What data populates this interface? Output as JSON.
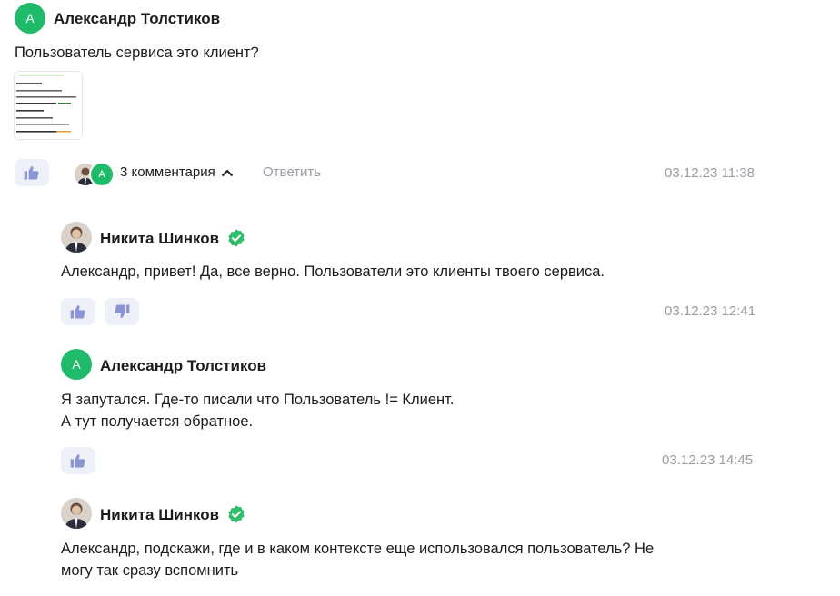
{
  "post": {
    "avatar_letter": "А",
    "author": "Александр Толстиков",
    "text": "Пользователь сервиса это клиент?",
    "comments_label": "3 комментария",
    "reply_label": "Ответить",
    "date": "03.12.23 11:38",
    "mini_avatar_letter": "А"
  },
  "comments": [
    {
      "author": "Никита Шинков",
      "text": "Александр, привет! Да, все верно. Пользователи это клиенты твоего сервиса.",
      "date": "03.12.23 12:41"
    },
    {
      "avatar_letter": "А",
      "author": "Александр Толстиков",
      "text_line1": "Я запутался. Где-то писали что Пользователь != Клиент.",
      "text_line2": "А тут получается обратное.",
      "date": "03.12.23 14:45"
    },
    {
      "author": "Никита Шинков",
      "text_line1": "Александр, подскажи, где и в каком контексте еще использовался пользователь? Не",
      "text_line2": "могу так сразу вспомнить"
    }
  ],
  "colors": {
    "avatar_green": "#1fba6a",
    "verified_green": "#2fbf6a",
    "button_bg": "#eef0f8",
    "icon_blue": "#8b95d6",
    "date_gray": "#9a9ca3"
  }
}
